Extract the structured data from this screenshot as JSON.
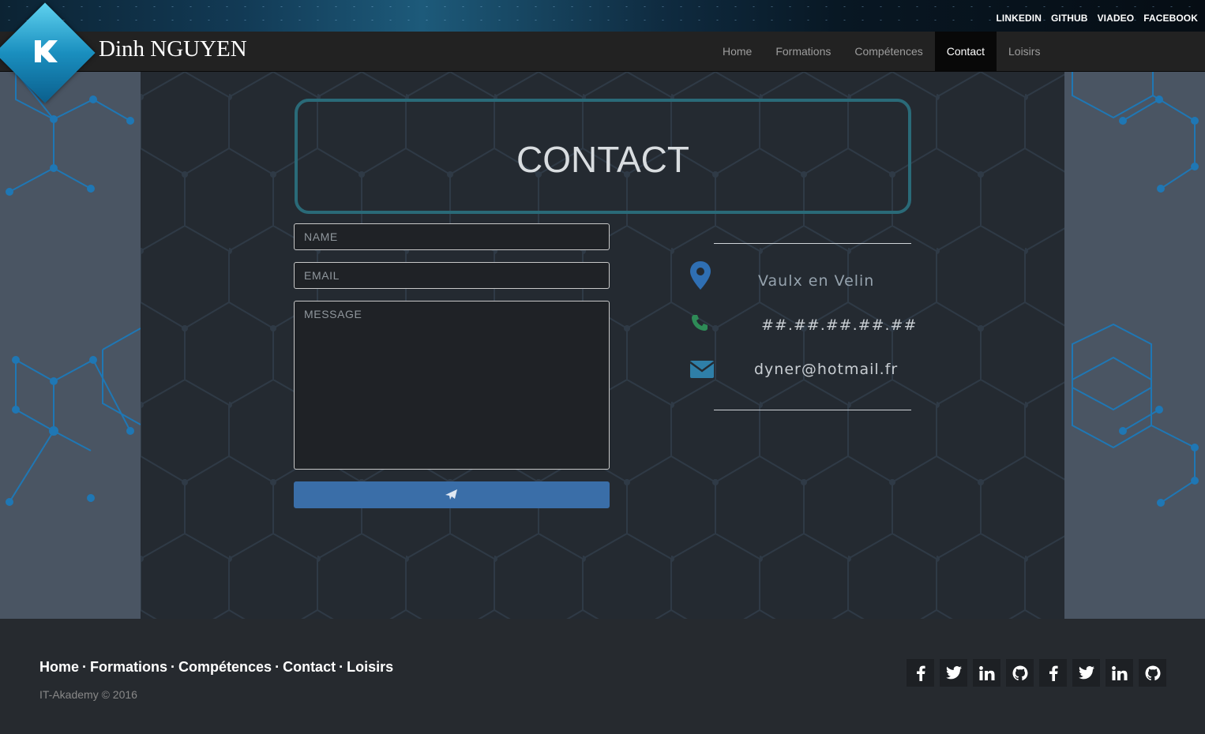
{
  "topbar": {
    "links": [
      "LINKEDIN",
      "GITHUB",
      "VIADEO",
      "FACEBOOK"
    ]
  },
  "navbar": {
    "brand": "Dinh NGUYEN",
    "items": [
      "Home",
      "Formations",
      "Compétences",
      "Contact",
      "Loisirs"
    ],
    "active": "Contact"
  },
  "main": {
    "title": "CONTACT",
    "form": {
      "name_placeholder": "NAME",
      "email_placeholder": "EMAIL",
      "message_placeholder": "MESSAGE",
      "send_icon": "paper-plane-icon"
    },
    "info": {
      "location": "Vaulx en Velin",
      "phone": "##.##.##.##.##",
      "email": "dyner@hotmail.fr"
    }
  },
  "footer": {
    "links": [
      "Home",
      "Formations",
      "Compétences",
      "Contact",
      "Loisirs"
    ],
    "separator": "·",
    "copyright": "IT-Akademy © 2016",
    "social_icons": [
      "facebook-icon",
      "twitter-icon",
      "linkedin-icon",
      "github-icon",
      "facebook-icon",
      "twitter-icon",
      "linkedin-icon",
      "github-icon"
    ]
  },
  "colors": {
    "accent_border": "#2a6a78",
    "send_button": "#3a6ea8",
    "location_icon": "#2f6fb3",
    "phone_icon": "#2e8b57",
    "mail_icon": "#2f7fa8"
  }
}
